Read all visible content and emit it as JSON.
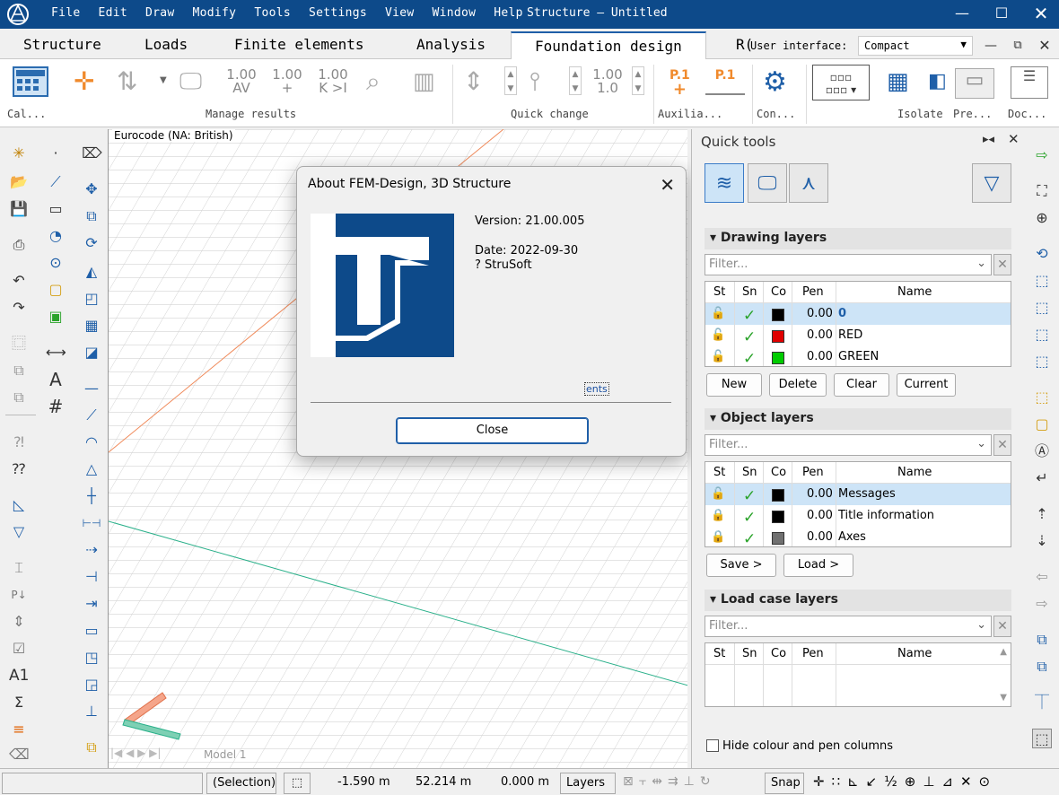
{
  "app": {
    "title": "Structure – Untitled",
    "menu": [
      "File",
      "Edit",
      "Draw",
      "Modify",
      "Tools",
      "Settings",
      "View",
      "Window",
      "Help"
    ]
  },
  "tabs": [
    "Structure",
    "Loads",
    "Finite elements",
    "Analysis",
    "Foundation design",
    "R("
  ],
  "user_interface": {
    "label": "User interface:",
    "value": "Compact"
  },
  "ribbon": {
    "groups": {
      "cal": "Cal...",
      "manage": "Manage results",
      "quick_change": "Quick change",
      "auxilia": "Auxilia...",
      "con": "Con...",
      "isolate": "Isolate",
      "pre": "Pre...",
      "doc": "Doc..."
    },
    "buttons": {
      "b100a": "1.00",
      "b100a2": "AV",
      "b100b": "1.00",
      "b100b2": "+",
      "b100c": "1.00",
      "b100c2": "K >I",
      "qc100": "1.00",
      "qc100b": "1.0",
      "p1": "P.1",
      "p1b": "P.1"
    }
  },
  "canvas": {
    "code": "Eurocode (NA: British)",
    "tab_model": "Model 1"
  },
  "dialog": {
    "title": "About FEM-Design, 3D Structure",
    "version": "Version: 21.00.005",
    "date": "Date: 2022-09-30",
    "copyright": "? StruSoft",
    "link_text": "ents",
    "close_label": "Close"
  },
  "quick_tools": {
    "title": "Quick tools",
    "drawing_layers": {
      "heading": "Drawing layers",
      "filter_placeholder": "Filter...",
      "columns": [
        "St",
        "Sn",
        "Co",
        "Pen",
        "Name"
      ],
      "rows": [
        {
          "pen": "0.00",
          "name": "0",
          "color": "#000000",
          "selected": true
        },
        {
          "pen": "0.00",
          "name": "RED",
          "color": "#e00000",
          "selected": false
        },
        {
          "pen": "0.00",
          "name": "GREEN",
          "color": "#00cc00",
          "selected": false
        }
      ],
      "buttons": [
        "New",
        "Delete",
        "Clear",
        "Current"
      ]
    },
    "object_layers": {
      "heading": "Object layers",
      "filter_placeholder": "Filter...",
      "columns": [
        "St",
        "Sn",
        "Co",
        "Pen",
        "Name"
      ],
      "rows": [
        {
          "pen": "0.00",
          "name": "Messages",
          "color": "#000000",
          "selected": true
        },
        {
          "pen": "0.00",
          "name": "Title information",
          "color": "#000000",
          "selected": false
        },
        {
          "pen": "0.00",
          "name": "Axes",
          "color": "#707070",
          "selected": false
        }
      ],
      "buttons": [
        "Save >",
        "Load >"
      ]
    },
    "load_case_layers": {
      "heading": "Load case layers",
      "filter_placeholder": "Filter...",
      "columns": [
        "St",
        "Sn",
        "Co",
        "Pen",
        "Name"
      ]
    },
    "hide_colour": "Hide colour and pen columns"
  },
  "status": {
    "selection": "(Selection)",
    "x": "-1.590 m",
    "y": "52.214 m",
    "z": "0.000 m",
    "layers": "Layers",
    "snap": "Snap"
  },
  "colors": {
    "titlebar": "#0d4a8a",
    "accent": "#1f5fa8",
    "selection": "#cde4f7"
  }
}
